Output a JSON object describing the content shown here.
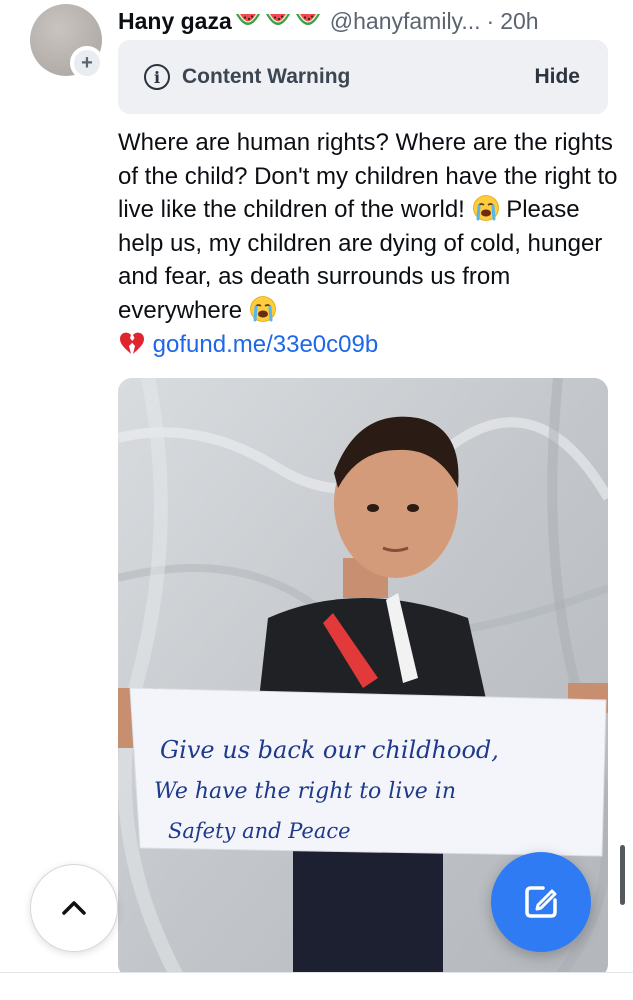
{
  "post": {
    "author": {
      "display_name": "Hany gaza",
      "emoji_icons": [
        "watermelon-icon",
        "watermelon-icon",
        "watermelon-icon"
      ],
      "handle": "@hanyfamily...",
      "separator": "·",
      "timestamp": "20h",
      "avatar_badge": "+"
    },
    "content_warning": {
      "icon": "i",
      "label": "Content Warning",
      "toggle_label": "Hide"
    },
    "text": {
      "part1": "Where are human rights? Where are the rights of the child? Don't my children have the right to live like the children of the world!",
      "part2": " Please help us, my children are dying of cold, hunger and fear, as death surrounds us from everywhere ",
      "link": "gofund.me/33e0c09b"
    },
    "emojis": [
      "loudly-crying-face-icon",
      "loudly-crying-face-icon",
      "broken-heart-icon"
    ],
    "image": {
      "sign_line1": "Give us back our childhood,",
      "sign_line2": "We have the right to live in",
      "sign_line3": "Safety and Peace"
    }
  },
  "controls": {
    "scroll_up_icon": "chevron-up-icon",
    "compose_icon": "compose-icon"
  },
  "colors": {
    "accent": "#2f7bf3",
    "link": "#1d67e8",
    "muted": "#5b6470",
    "cw_background": "#eef0f3"
  }
}
